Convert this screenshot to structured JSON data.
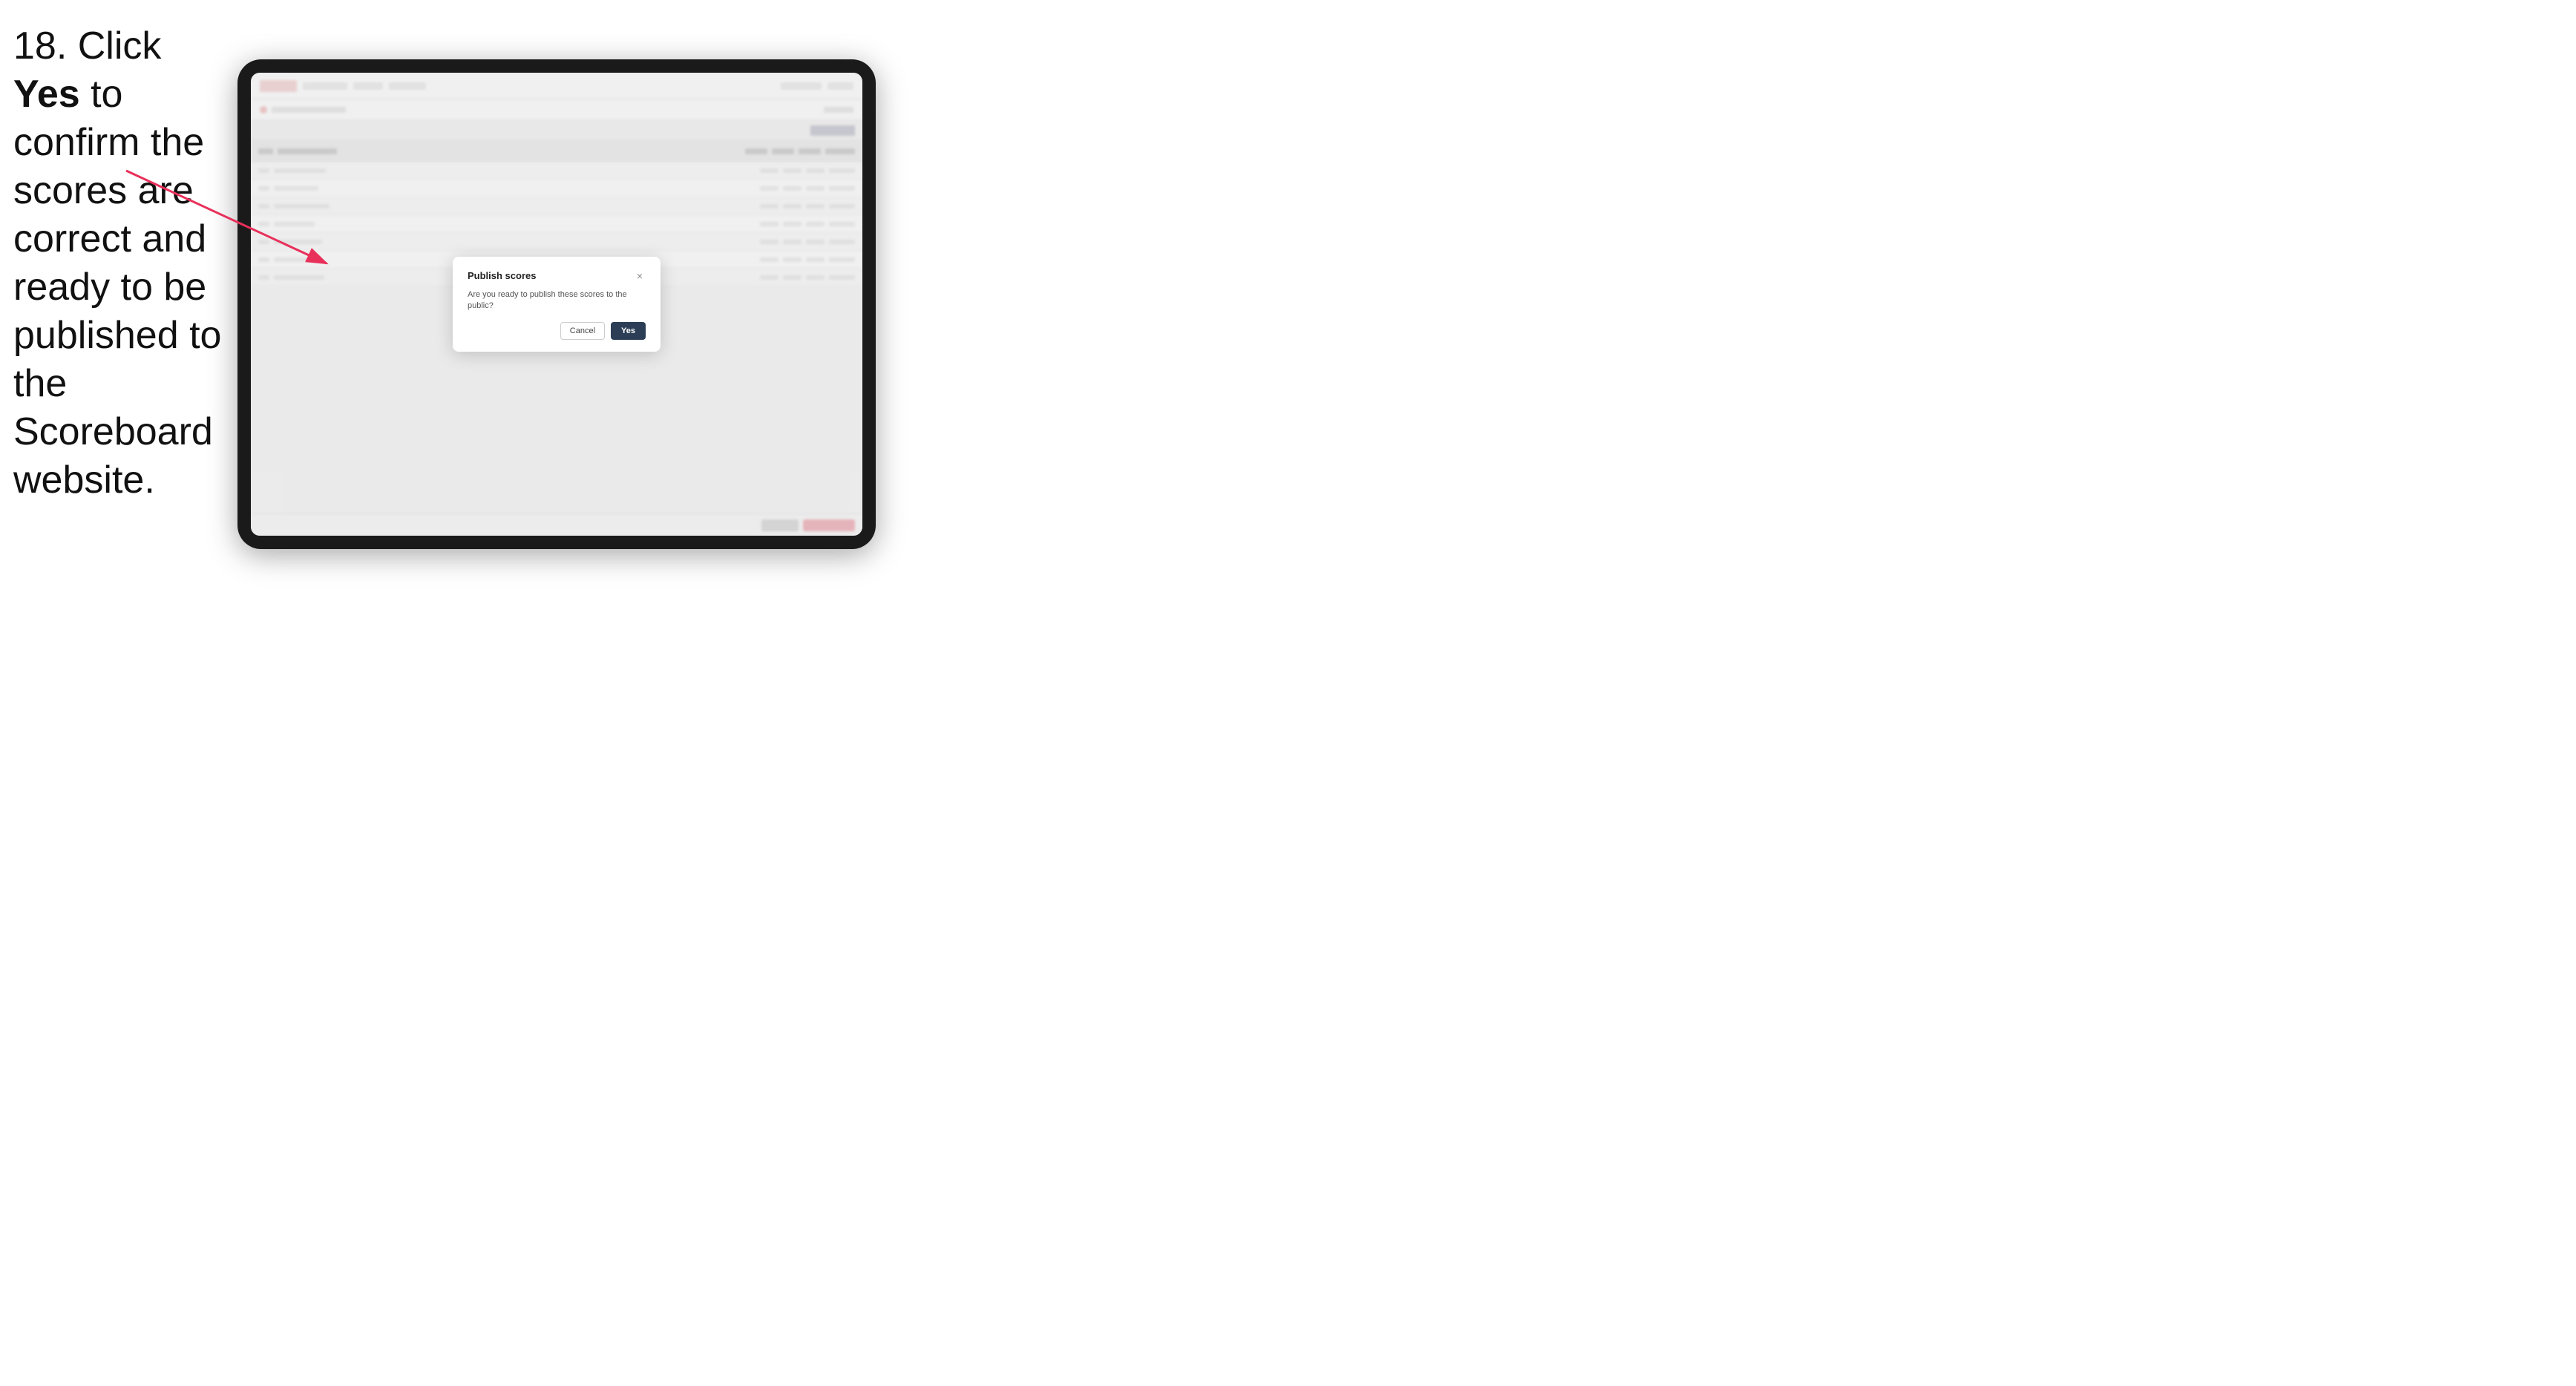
{
  "instruction": {
    "step": "18.",
    "text_before_bold": " Click ",
    "bold_text": "Yes",
    "text_after": " to confirm the scores are correct and ready to be published to the Scoreboard website."
  },
  "dialog": {
    "title": "Publish scores",
    "body_text": "Are you ready to publish these scores to the public?",
    "cancel_label": "Cancel",
    "yes_label": "Yes",
    "close_icon": "×"
  },
  "tablet": {
    "nav": {
      "logo_alt": "app-logo"
    },
    "table": {
      "rows": 7
    }
  },
  "arrow": {
    "description": "arrow pointing to dialog"
  }
}
